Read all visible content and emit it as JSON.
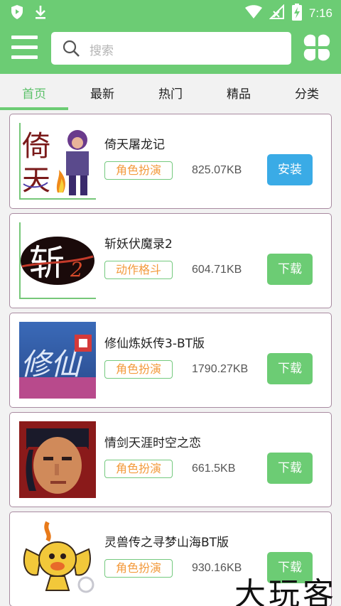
{
  "status_bar": {
    "time": "7:16",
    "icons": [
      "shield-icon",
      "download-icon",
      "wifi-icon",
      "signal-icon",
      "battery-charging-icon"
    ]
  },
  "header": {
    "search_placeholder": "搜索",
    "menu_icon": "hamburger-menu-icon",
    "clover_icon": "clover-icon",
    "color": "#6ccc74"
  },
  "tabs": [
    {
      "label": "首页",
      "active": true
    },
    {
      "label": "最新",
      "active": false
    },
    {
      "label": "热门",
      "active": false
    },
    {
      "label": "精品",
      "active": false
    },
    {
      "label": "分类",
      "active": false
    }
  ],
  "games": [
    {
      "title": "倚天屠龙记",
      "tag": "角色扮演",
      "size": "825.07KB",
      "action": "安装",
      "action_color": "#3aabe6"
    },
    {
      "title": "斩妖伏魔录2",
      "tag": "动作格斗",
      "size": "604.71KB",
      "action": "下载",
      "action_color": "#6ccc74"
    },
    {
      "title": "修仙炼妖传3-BT版",
      "tag": "角色扮演",
      "size": "1790.27KB",
      "action": "下载",
      "action_color": "#6ccc74"
    },
    {
      "title": "情剑天涯时空之恋",
      "tag": "角色扮演",
      "size": "661.5KB",
      "action": "下载",
      "action_color": "#6ccc74"
    },
    {
      "title": "灵兽传之寻梦山海BT版",
      "tag": "角色扮演",
      "size": "930.16KB",
      "action": "下载",
      "action_color": "#6ccc74"
    }
  ],
  "thumb_text": {
    "game0_a": "倚",
    "game0_b": "天",
    "game1": "斩",
    "game1_num": "2",
    "game2": "修仙"
  },
  "watermark": "大玩客"
}
